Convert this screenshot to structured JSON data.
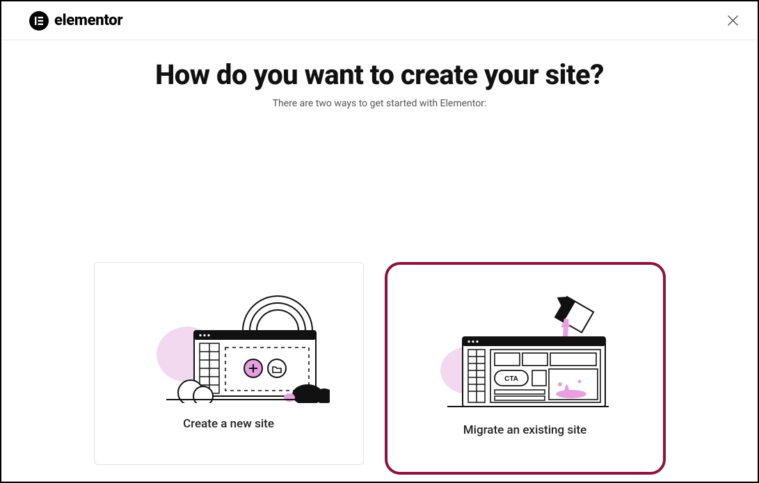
{
  "header": {
    "brand": "elementor"
  },
  "title": "How do you want to create your site?",
  "subtitle": "There are two ways to get started with Elementor:",
  "cards": {
    "create": {
      "label": "Create a new site"
    },
    "migrate": {
      "label": "Migrate an existing site",
      "cta_text": "CTA"
    }
  }
}
